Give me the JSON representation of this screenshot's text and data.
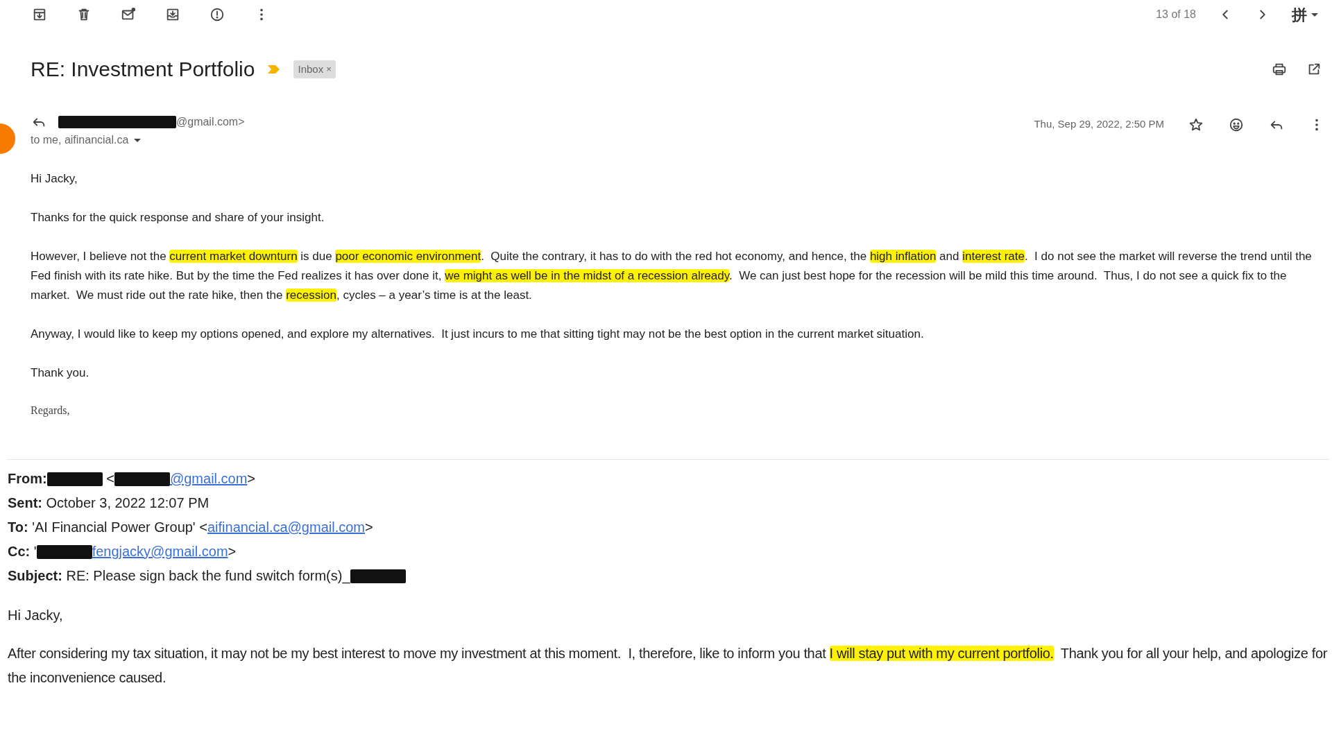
{
  "toolbar": {
    "pager": "13 of 18",
    "input_tool": "拼"
  },
  "subject": {
    "title": "RE: Investment Portfolio",
    "important": true,
    "labels": [
      {
        "text": "Inbox",
        "remove": "×"
      }
    ]
  },
  "message": {
    "sender_email": "@gmail.com>",
    "recipients": "to me, aifinancial.ca",
    "date": "Thu, Sep 29, 2022, 2:50 PM",
    "starred": false,
    "greeting": "Hi Jacky,",
    "paragraphs": [
      [
        {
          "text": "Thanks for the quick response and share of your insight.",
          "highlight": false
        }
      ],
      [
        {
          "text": "However, I believe not the ",
          "highlight": false
        },
        {
          "text": "current market downturn",
          "highlight": true
        },
        {
          "text": " is due ",
          "highlight": false
        },
        {
          "text": "poor economic environment",
          "highlight": true
        },
        {
          "text": ".  Quite the contrary, it has to do with the red hot economy, and hence, the ",
          "highlight": false
        },
        {
          "text": "high inflation",
          "highlight": true
        },
        {
          "text": " and ",
          "highlight": false
        },
        {
          "text": "interest rate",
          "highlight": true
        },
        {
          "text": ".  I do not see the market will reverse the trend until the Fed finish with its rate hike. But by the time the Fed realizes it has over done it, ",
          "highlight": false
        },
        {
          "text": "we might as well be in the midst of a recession already",
          "highlight": true
        },
        {
          "text": ".  We can just best hope for the recession will be mild this time around.  Thus, I do not see a quick fix to the market.  We must ride out the rate hike, then the ",
          "highlight": false
        },
        {
          "text": "recession",
          "highlight": true
        },
        {
          "text": ", cycles – a year’s time is at the least.",
          "highlight": false
        }
      ],
      [
        {
          "text": "Anyway, I would like to keep my options opened, and explore my alternatives.  It just incurs to me that sitting tight may not be the best option in the current market situation.",
          "highlight": false
        }
      ],
      [
        {
          "text": "Thank you.",
          "highlight": false
        }
      ]
    ],
    "signoff": "Regards,"
  },
  "quoted": {
    "fields": [
      {
        "label": "From:",
        "parts": [
          {
            "kind": "redaction"
          },
          {
            "kind": "text",
            "text": " <"
          },
          {
            "kind": "redaction"
          },
          {
            "kind": "link",
            "text": "@gmail.com"
          },
          {
            "kind": "text",
            "text": ">"
          }
        ]
      },
      {
        "label": "Sent:",
        "parts": [
          {
            "kind": "text",
            "text": " October 3, 2022 12:07 PM"
          }
        ]
      },
      {
        "label": "To:",
        "parts": [
          {
            "kind": "text",
            "text": " 'AI Financial Power Group' <"
          },
          {
            "kind": "link",
            "text": "aifinancial.ca@gmail.com"
          },
          {
            "kind": "text",
            "text": ">"
          }
        ]
      },
      {
        "label": "Cc:",
        "parts": [
          {
            "kind": "text",
            "text": " '"
          },
          {
            "kind": "redaction"
          },
          {
            "kind": "link",
            "text": "fengjacky@gmail.com"
          },
          {
            "kind": "text",
            "text": ">"
          }
        ]
      },
      {
        "label": "Subject:",
        "parts": [
          {
            "kind": "text",
            "text": " RE: Please sign back the fund switch form(s)_"
          },
          {
            "kind": "redaction"
          }
        ]
      }
    ],
    "greeting": "Hi Jacky,",
    "paragraphs": [
      [
        {
          "text": "After considering my tax situation, it may not be my best interest to move my investment at this moment.  I, therefore, like to inform you that ",
          "highlight": false
        },
        {
          "text": "I will stay put with my current portfolio.",
          "highlight": true
        },
        {
          "text": "  Thank you for all your help, and apologize for the inconvenience caused.",
          "highlight": false
        }
      ]
    ]
  }
}
